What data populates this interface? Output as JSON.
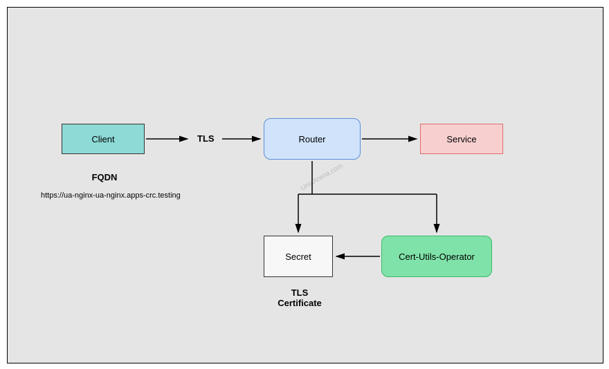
{
  "nodes": {
    "client": "Client",
    "router": "Router",
    "service": "Service",
    "secret": "Secret",
    "certop": "Cert-Utils-Operator"
  },
  "labels": {
    "fqdn": "FQDN",
    "fqdn_url": "https://ua-nginx-ua-nginx.apps-crc.testing",
    "tls": "TLS",
    "tls_cert_line1": "TLS",
    "tls_cert_line2": "Certificate"
  },
  "watermark": "UnixArena.com"
}
